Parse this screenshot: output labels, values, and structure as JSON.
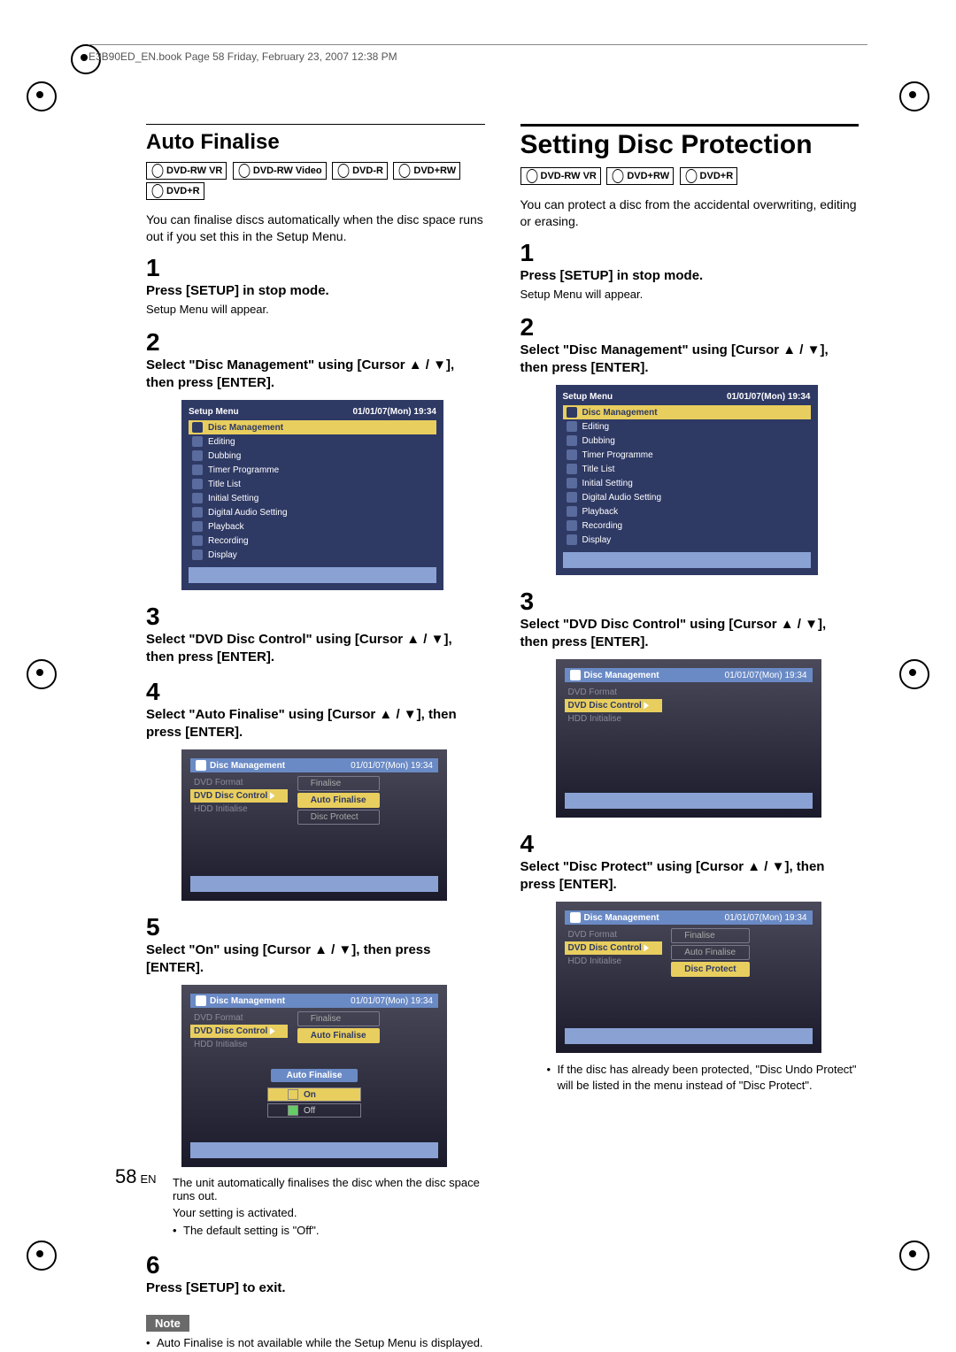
{
  "header": "E3B90ED_EN.book  Page 58  Friday, February 23, 2007  12:38 PM",
  "page_number": "58",
  "page_lang": "EN",
  "left": {
    "heading": "Auto Finalise",
    "badges": [
      "DVD-RW VR",
      "DVD-RW Video",
      "DVD-R",
      "DVD+RW",
      "DVD+R"
    ],
    "intro": "You can finalise discs automatically when the disc space runs out if you set this in the Setup Menu.",
    "steps": [
      {
        "n": "1",
        "title": "Press [SETUP] in stop mode.",
        "sub": "Setup Menu will appear."
      },
      {
        "n": "2",
        "title": "Select \"Disc Management\" using [Cursor ▲ / ▼], then press [ENTER]."
      },
      {
        "n": "3",
        "title": "Select \"DVD Disc Control\" using [Cursor ▲ / ▼], then press [ENTER]."
      },
      {
        "n": "4",
        "title": "Select \"Auto Finalise\" using [Cursor ▲ / ▼], then press [ENTER]."
      },
      {
        "n": "5",
        "title": "Select \"On\" using [Cursor ▲ / ▼], then press [ENTER]."
      },
      {
        "n": "6",
        "title": "Press [SETUP] to exit."
      }
    ],
    "after5": [
      "The unit automatically finalises the disc when the disc space runs out.",
      "Your setting is activated.",
      "The default setting is \"Off\"."
    ],
    "note_label": "Note",
    "note": "Auto Finalise is not available while the Setup Menu is displayed."
  },
  "right": {
    "heading": "Setting Disc Protection",
    "badges": [
      "DVD-RW VR",
      "DVD+RW",
      "DVD+R"
    ],
    "intro": "You can protect a disc from the accidental overwriting, editing or erasing.",
    "steps": [
      {
        "n": "1",
        "title": "Press [SETUP] in stop mode.",
        "sub": "Setup Menu will appear."
      },
      {
        "n": "2",
        "title": "Select \"Disc Management\" using [Cursor ▲ / ▼], then press [ENTER]."
      },
      {
        "n": "3",
        "title": "Select \"DVD Disc Control\" using [Cursor ▲ / ▼], then press [ENTER]."
      },
      {
        "n": "4",
        "title": "Select \"Disc Protect\" using [Cursor ▲ / ▼], then press [ENTER]."
      }
    ],
    "after4": "If the disc has already been protected, \"Disc Undo Protect\" will be listed in the menu instead of \"Disc Protect\"."
  },
  "setup_menu": {
    "title": "Setup Menu",
    "timestamp": "01/01/07(Mon)    19:34",
    "items": [
      "Disc Management",
      "Editing",
      "Dubbing",
      "Timer Programme",
      "Title List",
      "Initial Setting",
      "Digital Audio Setting",
      "Playback",
      "Recording",
      "Display"
    ]
  },
  "disc_mgmt_menu": {
    "title": "Disc Management",
    "timestamp": "01/01/07(Mon)    19:34",
    "left": [
      "DVD Format",
      "DVD Disc Control",
      "HDD Initialise"
    ],
    "right_finalise": [
      "Finalise",
      "Auto Finalise",
      "Disc Protect"
    ],
    "popup_title": "Auto Finalise",
    "popup_opts": [
      "On",
      "Off"
    ]
  }
}
